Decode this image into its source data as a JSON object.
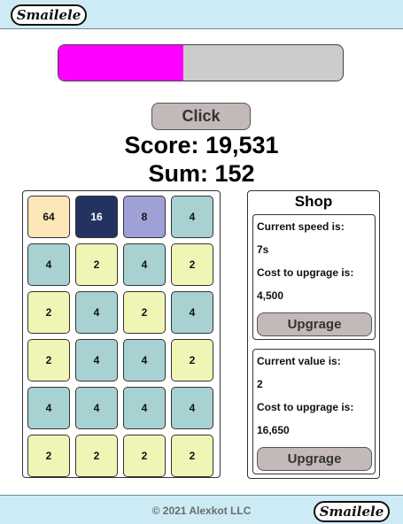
{
  "header": {
    "logo_text": "Smailele"
  },
  "progress": {
    "fraction": 0.44,
    "fill_color": "#ff00ff",
    "track_color": "#cccccc"
  },
  "click_button": {
    "label": "Click"
  },
  "score_text": "Score: 19,531",
  "sum_text": "Sum: 152",
  "board": {
    "rows": [
      [
        64,
        16,
        8,
        4
      ],
      [
        4,
        2,
        4,
        2
      ],
      [
        2,
        4,
        2,
        4
      ],
      [
        2,
        4,
        4,
        2
      ],
      [
        4,
        4,
        4,
        4
      ],
      [
        2,
        2,
        2,
        2
      ]
    ],
    "tile_colors": {
      "2": "#f0f5b6",
      "4": "#a8d1d1",
      "8": "#9fa0d6",
      "16": "#24325f",
      "64": "#fde6b8"
    },
    "tile_text_colors": {
      "16": "#ffffff"
    }
  },
  "shop": {
    "title": "Shop",
    "speed": {
      "label": "Current speed is:",
      "value": "7s",
      "cost_label": "Cost to upgrage is:",
      "cost_value": "4,500",
      "button_label": "Upgrage"
    },
    "value": {
      "label": "Current value is:",
      "value": "2",
      "cost_label": "Cost to upgrage is:",
      "cost_value": "16,650",
      "button_label": "Upgrage"
    }
  },
  "footer": {
    "copyright": "© 2021 Alexkot LLC",
    "logo_text": "Smailele"
  }
}
